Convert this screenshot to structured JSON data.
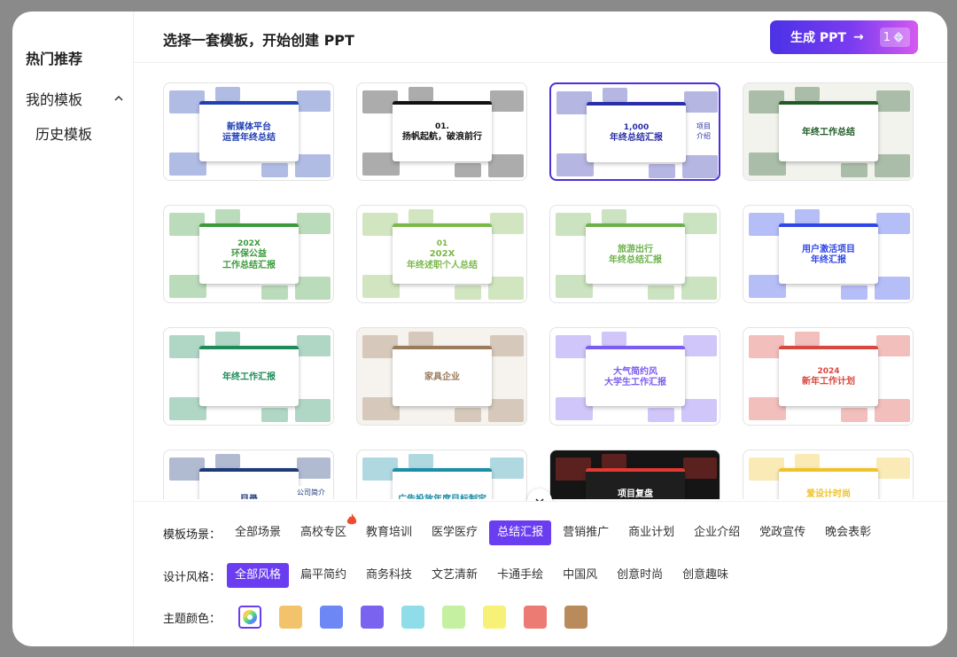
{
  "sidebar": {
    "hot": "热门推荐",
    "mine": "我的模板",
    "history": "历史模板"
  },
  "header": {
    "title": "选择一套模板，开始创建 PPT",
    "generate_label": "生成 PPT",
    "generate_arrow": "→",
    "credit_count": "1"
  },
  "templates": [
    {
      "title": "新媒体平台\n运营年终总结",
      "bg": "#ffffff",
      "accent": "#1f3fb5"
    },
    {
      "title": "扬帆起航，破浪前行",
      "bg": "#ffffff",
      "accent": "#111111",
      "sub": "01."
    },
    {
      "title": "年终总结汇报",
      "bg": "#ffffff",
      "accent": "#2a2fa8",
      "sub": "1,000",
      "small": "项目\n介绍"
    },
    {
      "title": "年终工作总结",
      "bg": "#f3f3ee",
      "accent": "#1f5a25"
    },
    {
      "title": "环保公益\n工作总结汇报",
      "bg": "#ffffff",
      "accent": "#3c9a3c",
      "sub": "202X"
    },
    {
      "title": "202X\n年终述职个人总结",
      "bg": "#ffffff",
      "accent": "#7bb84a",
      "sub": "01"
    },
    {
      "title": "旅游出行\n年终总结汇报",
      "bg": "#ffffff",
      "accent": "#6bb04a"
    },
    {
      "title": "用户激活项目\n年终汇报",
      "bg": "#ffffff",
      "accent": "#2f45e8"
    },
    {
      "title": "年终工作汇报",
      "bg": "#ffffff",
      "accent": "#1e8c58"
    },
    {
      "title": "家具企业",
      "bg": "#f6f3ee",
      "accent": "#9a7b5c"
    },
    {
      "title": "大气简约风\n大学生工作汇报",
      "bg": "#ffffff",
      "accent": "#7b5cf0"
    },
    {
      "title": "新年工作计划",
      "bg": "#ffffff",
      "accent": "#d9483f",
      "sub": "2024"
    },
    {
      "title": "目录",
      "bg": "#ffffff",
      "accent": "#1e3a7a",
      "small": "公司简介"
    },
    {
      "title": "广告投放年度目标制定",
      "bg": "#ffffff",
      "accent": "#1c8ea8"
    },
    {
      "title": "项目复盘\n年终总结汇报",
      "bg": "#151515",
      "accent": "#e03a32"
    },
    {
      "title": "爱设计时尚\n行业洞察报告",
      "bg": "#ffffff",
      "accent": "#f0c22a"
    }
  ],
  "filters": {
    "scene_label": "模板场景：",
    "scenes": [
      "全部场景",
      "高校专区",
      "教育培训",
      "医学医疗",
      "总结汇报",
      "营销推广",
      "商业计划",
      "企业介绍",
      "党政宣传",
      "晚会表彰"
    ],
    "style_label": "设计风格：",
    "styles": [
      "全部风格",
      "扁平简约",
      "商务科技",
      "文艺清新",
      "卡通手绘",
      "中国风",
      "创意时尚",
      "创意趣味"
    ],
    "color_label": "主题颜色：",
    "colors": [
      "#f2c36b",
      "#6d88f5",
      "#7a63ef",
      "#8fdde8",
      "#c5f0a2",
      "#f7f177",
      "#ec7b73",
      "#b98a5a"
    ]
  }
}
